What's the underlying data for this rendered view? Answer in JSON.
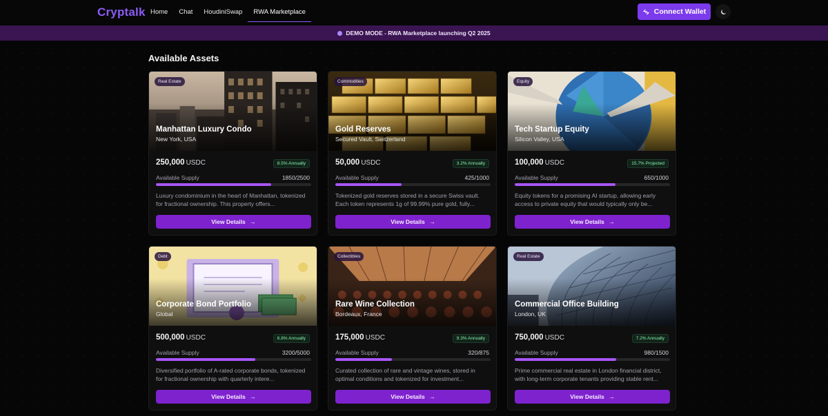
{
  "header": {
    "brand": "Cryptalk",
    "nav": [
      {
        "label": "Home",
        "active": false
      },
      {
        "label": "Chat",
        "active": false
      },
      {
        "label": "HoudiniSwap",
        "active": false
      },
      {
        "label": "RWA Marketplace",
        "active": true
      }
    ],
    "wallet_label": "Connect Wallet",
    "wallet_icon": "wallet-icon",
    "theme_icon": "moon-icon"
  },
  "banner": {
    "text": "DEMO MODE - RWA Marketplace launching Q2 2025"
  },
  "section_title": "Available Assets",
  "assets": [
    {
      "badge": "Real Estate",
      "title": "Manhattan Luxury Condo",
      "location": "New York, USA",
      "price": "250,000",
      "unit": "USDC",
      "yield": "8.5% Annually",
      "supply_label": "Available Supply",
      "supply": "1850/2500",
      "progress": 0.74,
      "description": "Luxury condominium in the heart of Manhattan, tokenized for fractional ownership. This property offers...",
      "button": "View Details",
      "image": "city"
    },
    {
      "badge": "Commodities",
      "title": "Gold Reserves",
      "location": "Secured Vault, Switzerland",
      "price": "50,000",
      "unit": "USDC",
      "yield": "3.2% Annually",
      "supply_label": "Available Supply",
      "supply": "425/1000",
      "progress": 0.425,
      "description": "Tokenized gold reserves stored in a secure Swiss vault. Each token represents 1g of 99.99% pure gold, fully...",
      "button": "View Details",
      "image": "gold"
    },
    {
      "badge": "Equity",
      "title": "Tech Startup Equity",
      "location": "Silicon Valley, USA",
      "price": "100,000",
      "unit": "USDC",
      "yield": "15.7% Projected",
      "supply_label": "Available Supply",
      "supply": "650/1000",
      "progress": 0.65,
      "description": "Equity tokens for a promising AI startup, allowing early access to private equity that would typically only be...",
      "button": "View Details",
      "image": "pie"
    },
    {
      "badge": "Debt",
      "title": "Corporate Bond Portfolio",
      "location": "Global",
      "price": "500,000",
      "unit": "USDC",
      "yield": "6.8% Annually",
      "supply_label": "Available Supply",
      "supply": "3200/5000",
      "progress": 0.64,
      "description": "Diversified portfolio of A-rated corporate bonds, tokenized for fractional ownership with quarterly intere...",
      "button": "View Details",
      "image": "bond"
    },
    {
      "badge": "Collectibles",
      "title": "Rare Wine Collection",
      "location": "Bordeaux, France",
      "price": "175,000",
      "unit": "USDC",
      "yield": "9.3% Annually",
      "supply_label": "Available Supply",
      "supply": "320/875",
      "progress": 0.366,
      "description": "Curated collection of rare and vintage wines, stored in optimal conditions and tokenized for investment...",
      "button": "View Details",
      "image": "wine"
    },
    {
      "badge": "Real Estate",
      "title": "Commercial Office Building",
      "location": "London, UK",
      "price": "750,000",
      "unit": "USDC",
      "yield": "7.2% Annually",
      "supply_label": "Available Supply",
      "supply": "980/1500",
      "progress": 0.653,
      "description": "Prime commercial real estate in London financial district, with long-term corporate tenants providing stable rent...",
      "button": "View Details",
      "image": "tower"
    }
  ],
  "colors": {
    "accent": "#8b5cf6",
    "button": "#7e22ce",
    "banner": "#3b1452",
    "yield_text": "#86efac"
  }
}
